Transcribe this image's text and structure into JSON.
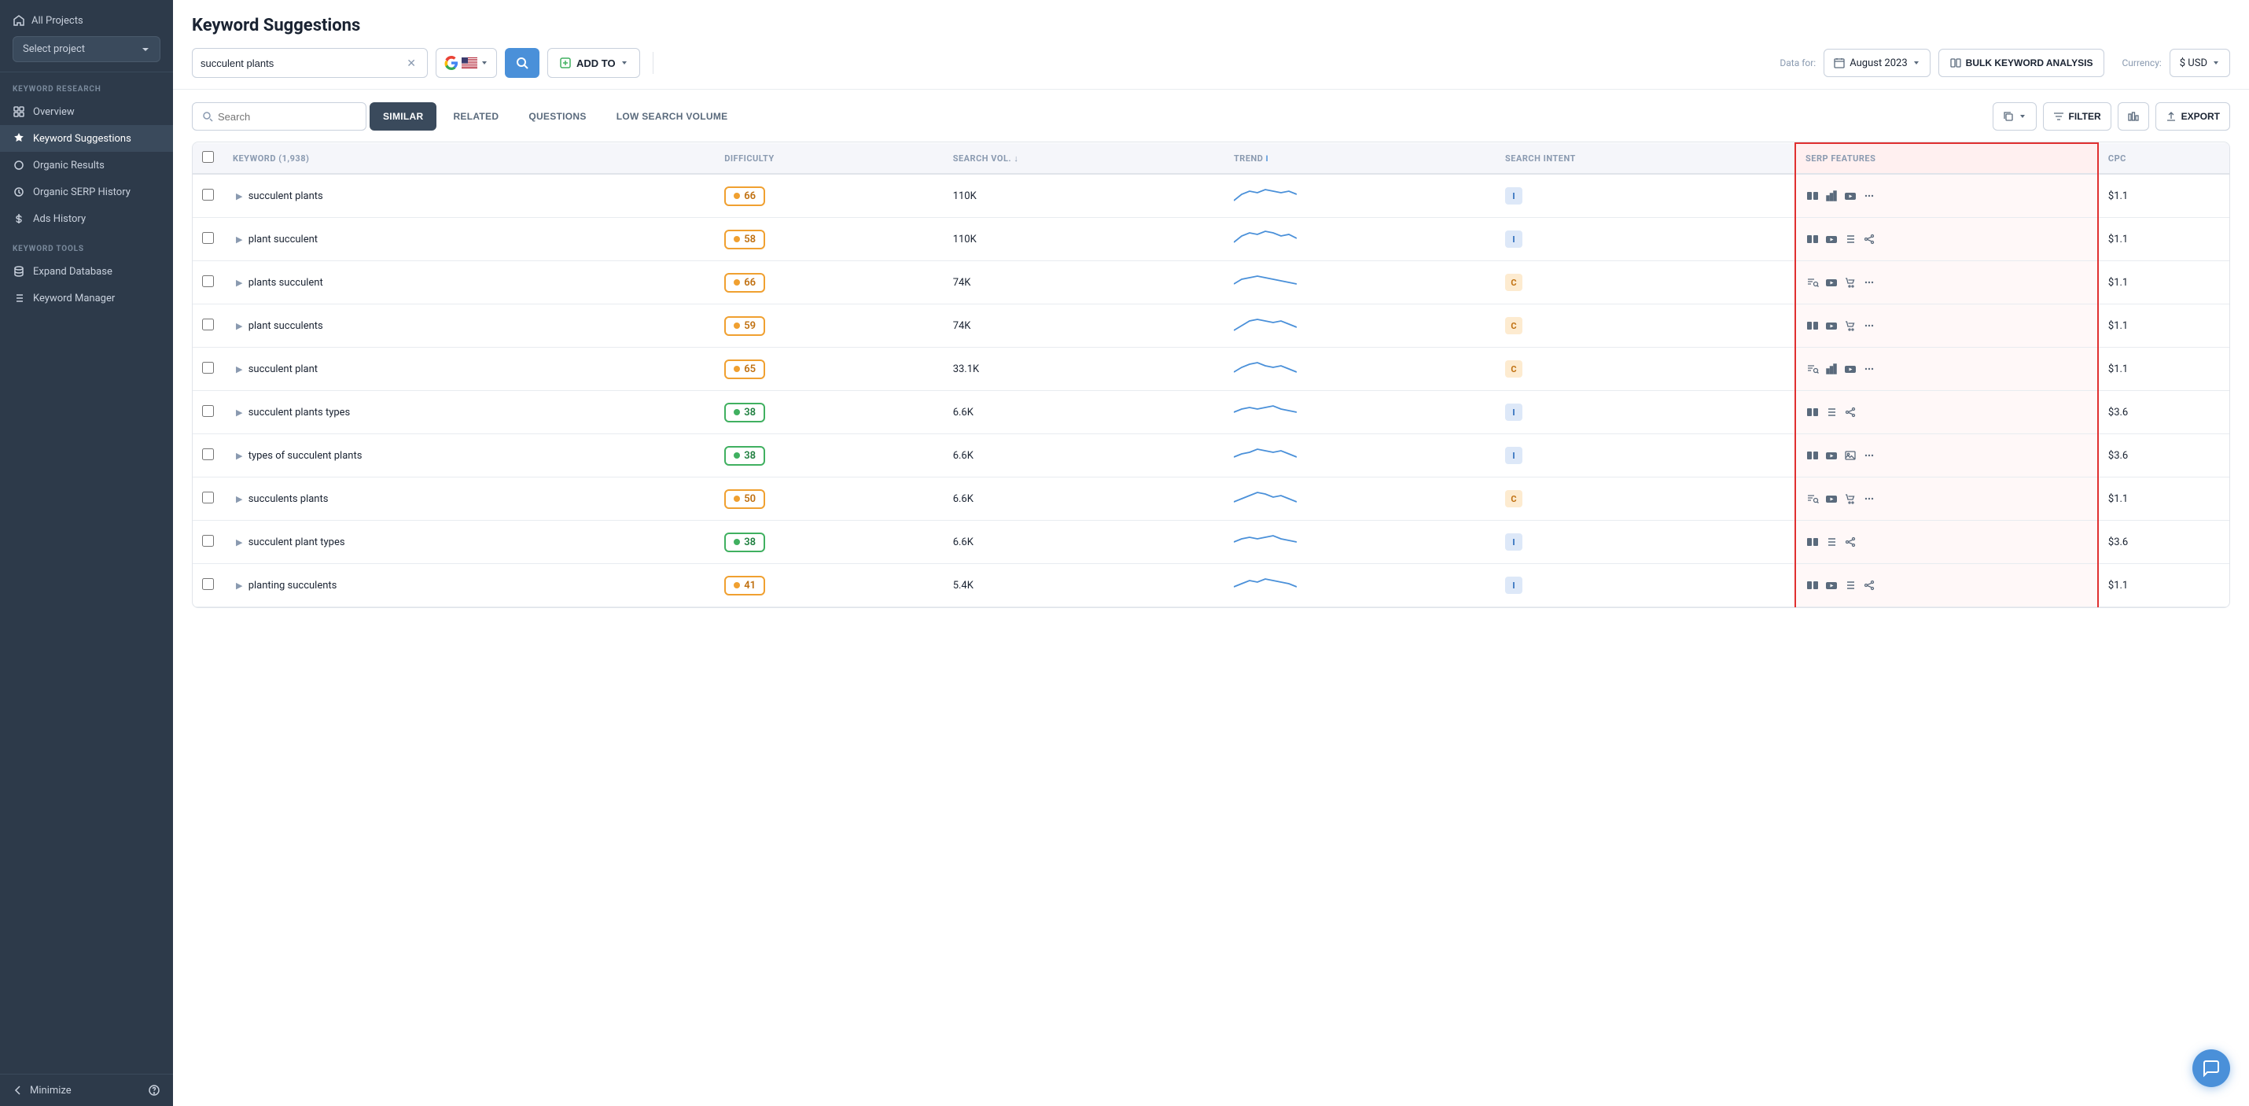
{
  "sidebar": {
    "all_projects_label": "All Projects",
    "project_placeholder": "Select project",
    "sections": [
      {
        "label": "KEYWORD RESEARCH",
        "items": [
          {
            "id": "overview",
            "label": "Overview",
            "icon": "grid-icon"
          },
          {
            "id": "keyword-suggestions",
            "label": "Keyword Suggestions",
            "icon": "star-icon",
            "active": true
          },
          {
            "id": "organic-results",
            "label": "Organic Results",
            "icon": "circle-icon"
          },
          {
            "id": "organic-serp-history",
            "label": "Organic SERP History",
            "icon": "clock-icon"
          },
          {
            "id": "ads-history",
            "label": "Ads History",
            "icon": "dollar-icon"
          }
        ]
      },
      {
        "label": "KEYWORD TOOLS",
        "items": [
          {
            "id": "expand-database",
            "label": "Expand Database",
            "icon": "db-icon"
          },
          {
            "id": "keyword-manager",
            "label": "Keyword Manager",
            "icon": "list-icon"
          }
        ]
      }
    ],
    "minimize_label": "Minimize"
  },
  "header": {
    "title": "Keyword Suggestions",
    "search_value": "succulent plants",
    "search_placeholder": "succulent plants",
    "add_to_label": "ADD TO",
    "data_for_label": "Data for:",
    "date_value": "August 2023",
    "bulk_label": "BULK KEYWORD ANALYSIS",
    "currency_label": "Currency:",
    "currency_value": "$ USD"
  },
  "tabs": {
    "search_placeholder": "Search",
    "items": [
      {
        "id": "similar",
        "label": "SIMILAR",
        "active": true
      },
      {
        "id": "related",
        "label": "RELATED",
        "active": false
      },
      {
        "id": "questions",
        "label": "QUESTIONS",
        "active": false
      },
      {
        "id": "low-search-volume",
        "label": "LOW SEARCH VOLUME",
        "active": false
      }
    ],
    "filter_label": "FILTER",
    "export_label": "EXPORT"
  },
  "table": {
    "columns": [
      {
        "id": "keyword",
        "label": "KEYWORD (1,938)",
        "sortable": false
      },
      {
        "id": "difficulty",
        "label": "DIFFICULTY",
        "sortable": false
      },
      {
        "id": "search_vol",
        "label": "SEARCH VOL.",
        "sortable": true
      },
      {
        "id": "trend",
        "label": "TREND",
        "sortable": false,
        "info": true
      },
      {
        "id": "search_intent",
        "label": "SEARCH INTENT",
        "sortable": false
      },
      {
        "id": "serp_features",
        "label": "SERP FEATURES",
        "sortable": false,
        "highlight": true
      },
      {
        "id": "cpc",
        "label": "CPC",
        "sortable": false
      }
    ],
    "rows": [
      {
        "keyword": "succulent plants",
        "difficulty": 66,
        "diff_color": "orange",
        "search_vol": "110K",
        "intent": "I",
        "intent_type": "i",
        "serp_icons": [
          "video-pack",
          "bar-chart",
          "youtube",
          "more"
        ],
        "cpc": "$1.1"
      },
      {
        "keyword": "plant succulent",
        "difficulty": 58,
        "diff_color": "orange",
        "search_vol": "110K",
        "intent": "I",
        "intent_type": "i",
        "serp_icons": [
          "video-pack",
          "youtube",
          "list",
          "share"
        ],
        "cpc": "$1.1"
      },
      {
        "keyword": "plants succulent",
        "difficulty": 66,
        "diff_color": "orange",
        "search_vol": "74K",
        "intent": "C",
        "intent_type": "c",
        "serp_icons": [
          "list-search",
          "youtube",
          "cart",
          "more"
        ],
        "cpc": "$1.1"
      },
      {
        "keyword": "plant succulents",
        "difficulty": 59,
        "diff_color": "orange",
        "search_vol": "74K",
        "intent": "C",
        "intent_type": "c",
        "serp_icons": [
          "video-pack",
          "youtube",
          "cart",
          "more"
        ],
        "cpc": "$1.1"
      },
      {
        "keyword": "succulent plant",
        "difficulty": 65,
        "diff_color": "orange",
        "search_vol": "33.1K",
        "intent": "C",
        "intent_type": "c",
        "serp_icons": [
          "list-search",
          "bar-chart",
          "youtube",
          "more"
        ],
        "cpc": "$1.1"
      },
      {
        "keyword": "succulent plants types",
        "difficulty": 38,
        "diff_color": "green",
        "search_vol": "6.6K",
        "intent": "I",
        "intent_type": "i",
        "serp_icons": [
          "video-pack",
          "list",
          "share"
        ],
        "cpc": "$3.6"
      },
      {
        "keyword": "types of succulent plants",
        "difficulty": 38,
        "diff_color": "green",
        "search_vol": "6.6K",
        "intent": "I",
        "intent_type": "i",
        "serp_icons": [
          "video-pack",
          "youtube",
          "image",
          "more"
        ],
        "cpc": "$3.6"
      },
      {
        "keyword": "succulents plants",
        "difficulty": 50,
        "diff_color": "orange",
        "search_vol": "6.6K",
        "intent": "C",
        "intent_type": "c",
        "serp_icons": [
          "list-search",
          "youtube",
          "cart",
          "more"
        ],
        "cpc": "$1.1"
      },
      {
        "keyword": "succulent plant types",
        "difficulty": 38,
        "diff_color": "green",
        "search_vol": "6.6K",
        "intent": "I",
        "intent_type": "i",
        "serp_icons": [
          "video-pack",
          "list",
          "share"
        ],
        "cpc": "$3.6"
      },
      {
        "keyword": "planting succulents",
        "difficulty": 41,
        "diff_color": "orange",
        "search_vol": "5.4K",
        "intent": "I",
        "intent_type": "i",
        "serp_icons": [
          "video-pack",
          "youtube",
          "list",
          "share"
        ],
        "cpc": "$1.1"
      }
    ]
  },
  "chat_btn_label": "Chat"
}
